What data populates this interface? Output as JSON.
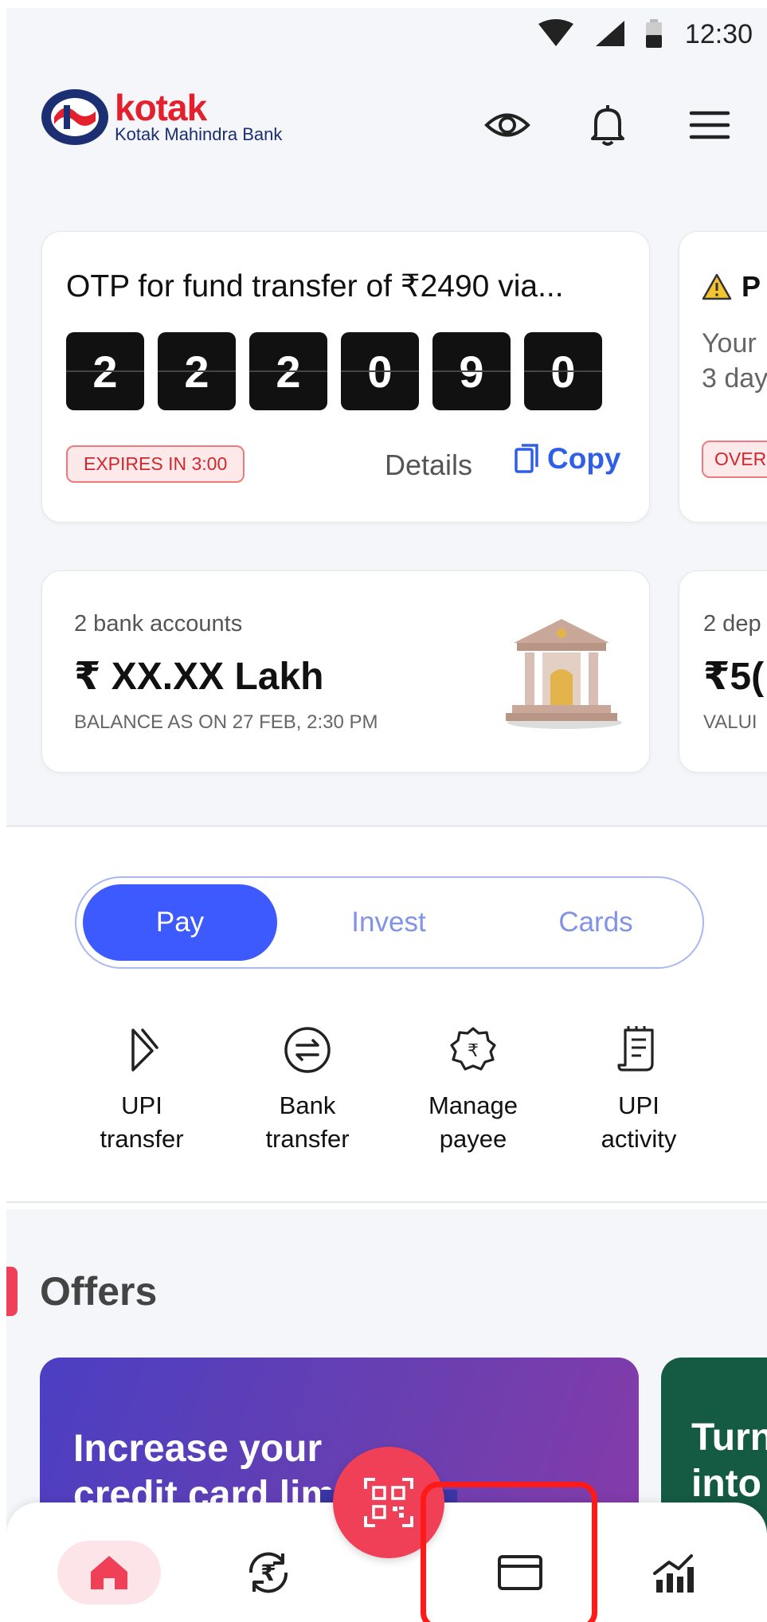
{
  "status_bar": {
    "time": "12:30"
  },
  "header": {
    "brand": "kotak",
    "bank_name": "Kotak Mahindra Bank",
    "icons": [
      "eye-icon",
      "bell-icon",
      "menu-icon"
    ]
  },
  "otp_card": {
    "title": "OTP for fund transfer of ₹2490 via...",
    "digits": [
      "2",
      "2",
      "2",
      "0",
      "9",
      "0"
    ],
    "expires": "EXPIRES IN 3:00",
    "details_label": "Details",
    "copy_label": "Copy"
  },
  "peek_card": {
    "title": "P",
    "line1": "Your",
    "line2": "3 day",
    "badge": "OVER"
  },
  "account_card": {
    "label": "2 bank accounts",
    "balance": "₹ XX.XX Lakh",
    "sub": "BALANCE AS ON 27 FEB, 2:30 PM"
  },
  "deposit_peek": {
    "label": "2 dep",
    "value": "₹5(",
    "sub": "VALUI"
  },
  "tabs": [
    {
      "label": "Pay",
      "active": true
    },
    {
      "label": "Invest",
      "active": false
    },
    {
      "label": "Cards",
      "active": false
    }
  ],
  "quick_actions": [
    {
      "line1": "UPI",
      "line2": "transfer",
      "icon": "upi-icon"
    },
    {
      "line1": "Bank",
      "line2": "transfer",
      "icon": "bank-transfer-icon"
    },
    {
      "line1": "Manage",
      "line2": "payee",
      "icon": "manage-payee-icon"
    },
    {
      "line1": "UPI",
      "line2": "activity",
      "icon": "receipt-icon"
    }
  ],
  "offers": {
    "title": "Offers",
    "offer1": {
      "line1": "Increase your",
      "line2": "credit card lim"
    },
    "offer2": {
      "line1": "Turn",
      "line2": "into"
    }
  },
  "bottom_nav": {
    "items": [
      "home-icon",
      "rupee-exchange-icon",
      "qr-scan-icon",
      "card-icon",
      "analytics-icon"
    ]
  },
  "colors": {
    "accent": "#3d5afe",
    "brand_red": "#e4202d",
    "qr_pink": "#ef4057",
    "highlight": "#ff1a1a"
  }
}
